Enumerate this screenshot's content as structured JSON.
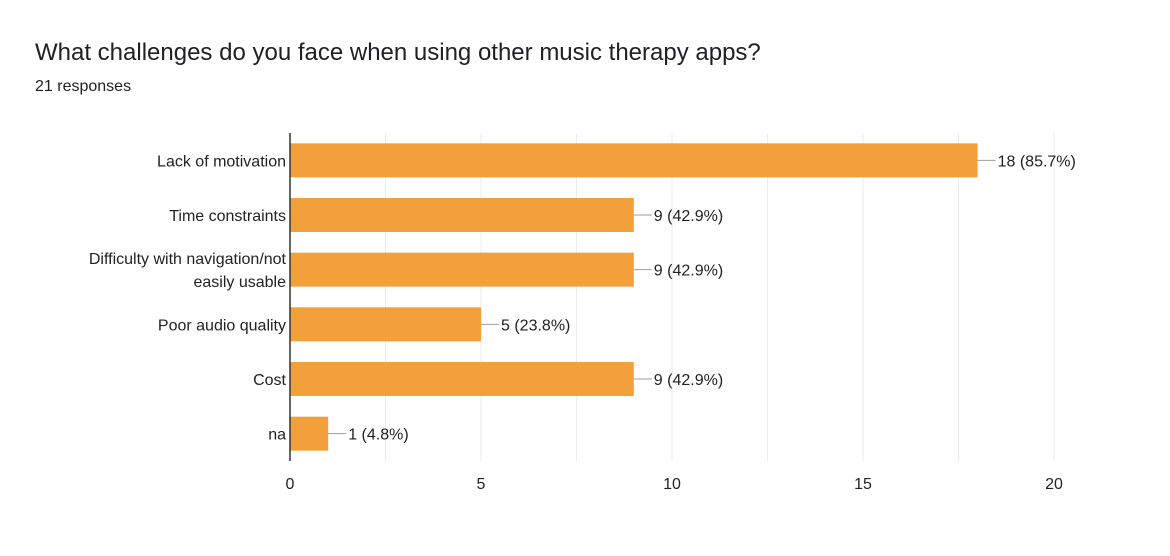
{
  "question": {
    "title": "What challenges do you face when using other music therapy apps?",
    "responses": "21 responses"
  },
  "colors": {
    "bar": "#f2a03a",
    "grid": "#ebebeb",
    "axis": "#333333",
    "leader": "#9e9e9e"
  },
  "chart_data": {
    "type": "bar",
    "orientation": "horizontal",
    "categories": [
      [
        "Lack of motivation"
      ],
      [
        "Time constraints"
      ],
      [
        "Difficulty with navigation/not",
        "easily usable"
      ],
      [
        "Poor audio quality"
      ],
      [
        "Cost"
      ],
      [
        "na"
      ]
    ],
    "values": [
      18,
      9,
      9,
      5,
      9,
      1
    ],
    "data_labels": [
      "18 (85.7%)",
      "9 (42.9%)",
      "9 (42.9%)",
      "5 (23.8%)",
      "9 (42.9%)",
      "1 (4.8%)"
    ],
    "xlim": [
      0,
      20
    ],
    "xticks": [
      0,
      5,
      10,
      15,
      20
    ],
    "grid": true
  }
}
